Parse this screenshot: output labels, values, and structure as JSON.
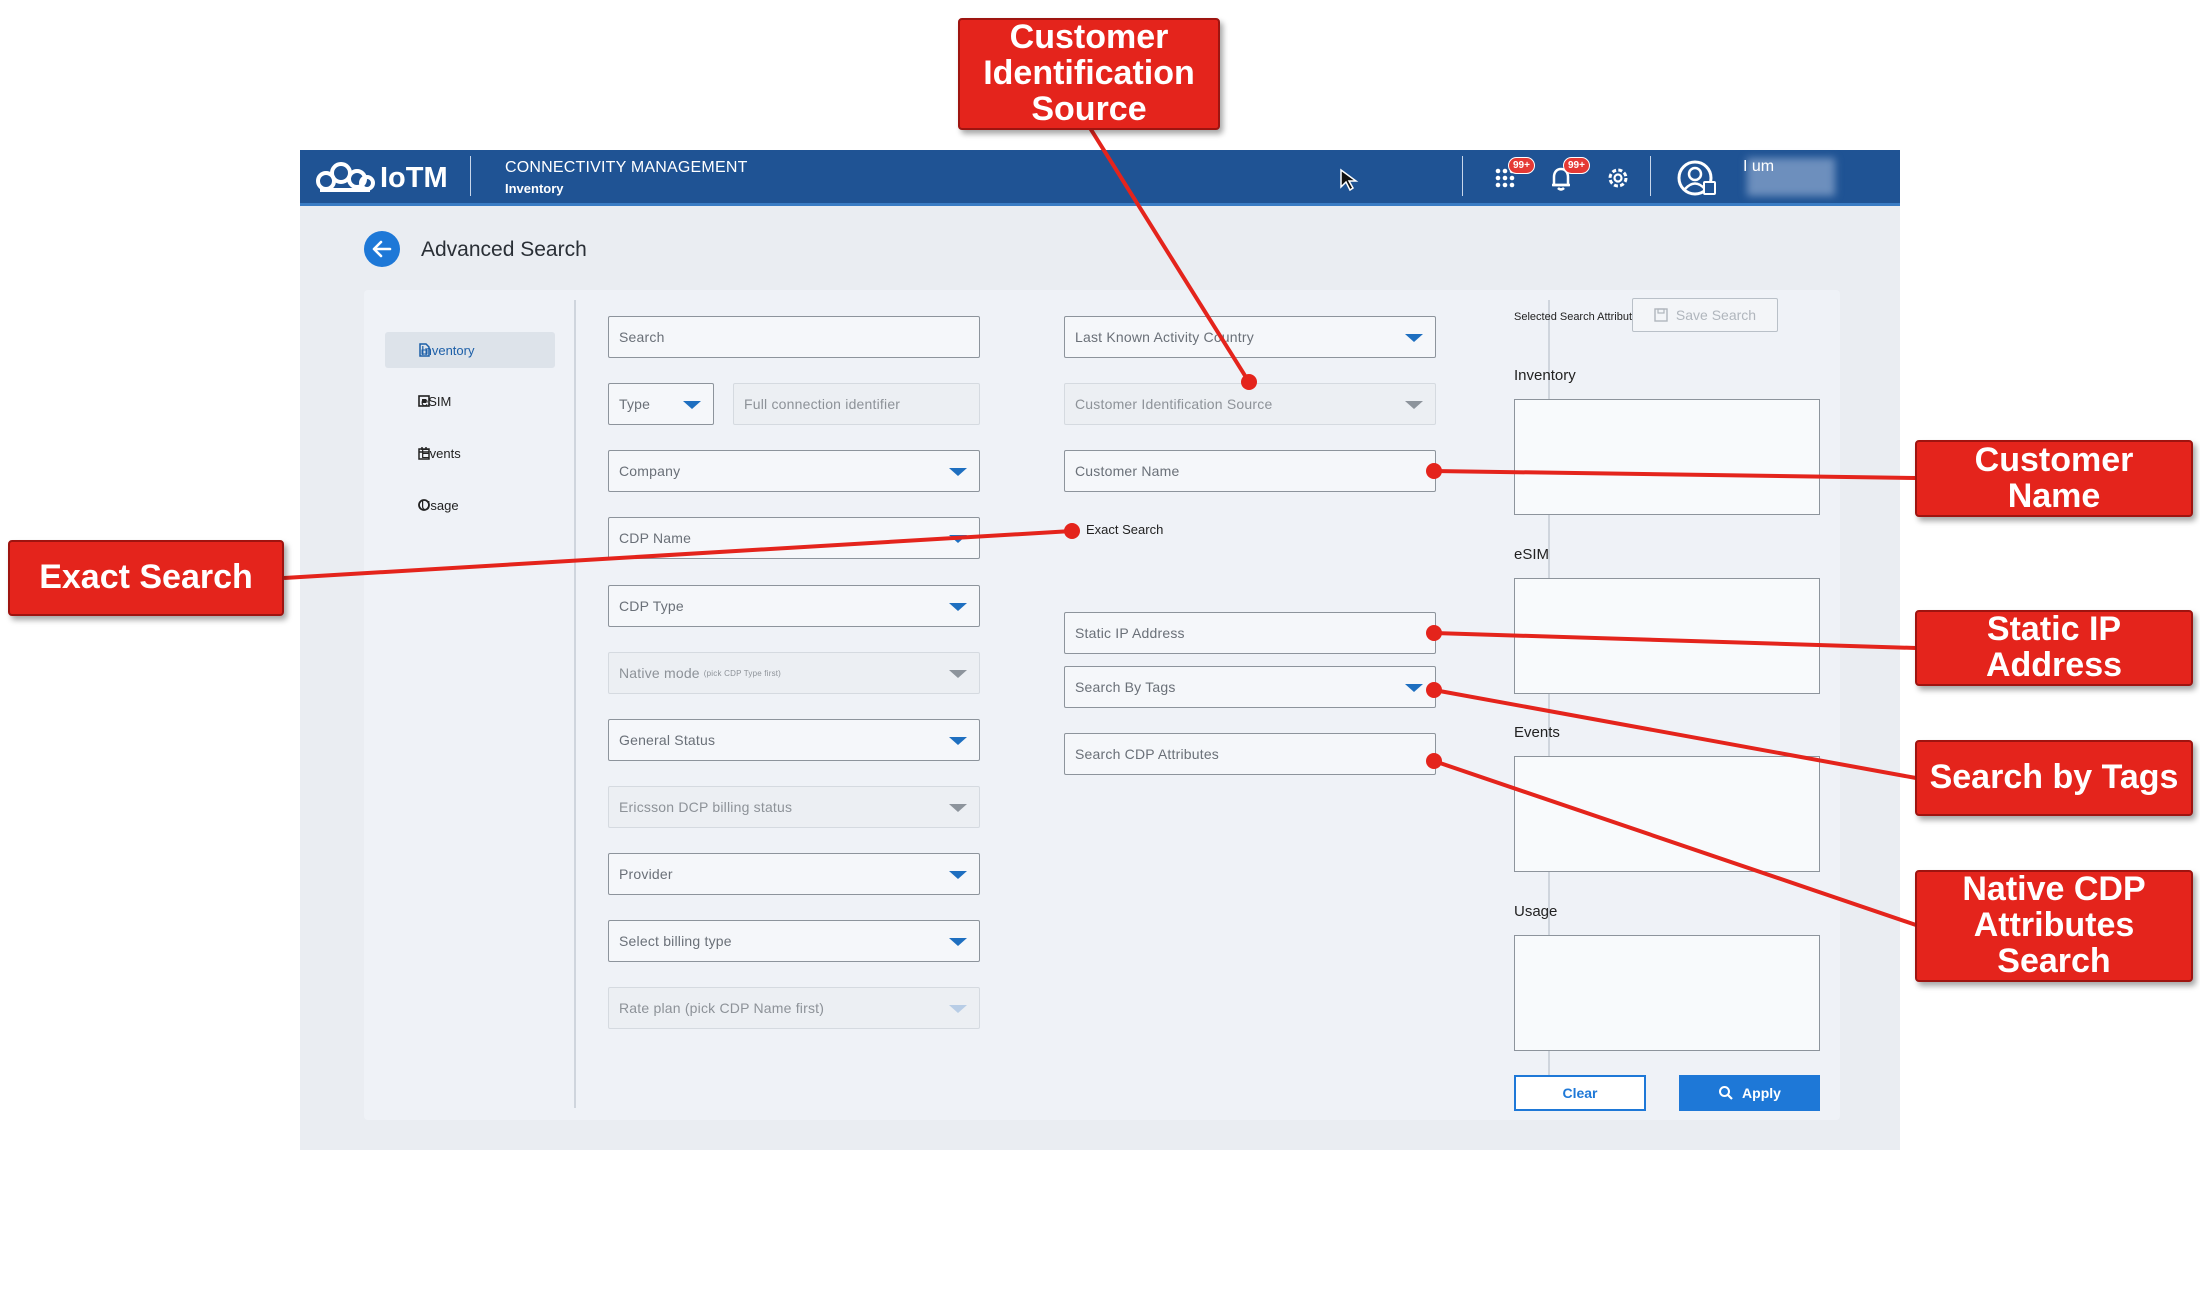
{
  "topbar": {
    "logo_text": "IoTM",
    "module_title": "CONNECTIVITY MANAGEMENT",
    "module_sub": "Inventory",
    "apps_badge": "99+",
    "notif_badge": "99+",
    "user_name": "I              um"
  },
  "page": {
    "title": "Advanced Search"
  },
  "sidebar": {
    "items": [
      {
        "label": "Inventory",
        "icon": "sim-card-icon"
      },
      {
        "label": "eSIM",
        "icon": "chip-icon"
      },
      {
        "label": "Events",
        "icon": "calendar-icon"
      },
      {
        "label": "Usage",
        "icon": "circle-icon"
      }
    ]
  },
  "form": {
    "col1": {
      "search_placeholder": "Search",
      "type_placeholder": "Type",
      "full_connection_placeholder": "Full connection identifier",
      "company": "Company",
      "cdp_name": "CDP Name",
      "cdp_type": "CDP Type",
      "native_mode": "Native mode",
      "native_mode_hint": "(pick CDP Type first)",
      "general_status": "General Status",
      "billing_status": "Ericsson DCP billing status",
      "provider": "Provider",
      "billing_type": "Select billing type",
      "rate_plan": "Rate plan (pick CDP Name first)"
    },
    "col2": {
      "last_known_country": "Last Known Activity Country",
      "customer_id_source": "Customer Identification Source",
      "customer_name": "Customer Name",
      "exact_search": "Exact Search",
      "static_ip": "Static IP Address",
      "search_by_tags": "Search By Tags",
      "search_cdp_attributes": "Search CDP Attributes"
    }
  },
  "selected": {
    "title": "Selected Search Attributes",
    "save_label": "Save Search",
    "groups": [
      "Inventory",
      "eSIM",
      "Events",
      "Usage"
    ],
    "clear_label": "Clear",
    "apply_label": "Apply"
  },
  "annotations": {
    "customer_id_source": [
      "Customer",
      "Identification",
      "Source"
    ],
    "customer_name": [
      "Customer",
      "Name"
    ],
    "exact_search": [
      "Exact Search"
    ],
    "static_ip": [
      "Static IP",
      "Address"
    ],
    "search_by_tags": [
      "Search by Tags"
    ],
    "native_cdp": [
      "Native CDP",
      "Attributes",
      "Search"
    ]
  },
  "colors": {
    "topbar": "#1f5394",
    "accent": "#1e78d7",
    "callout": "#e4241c",
    "badge": "#e53935"
  }
}
